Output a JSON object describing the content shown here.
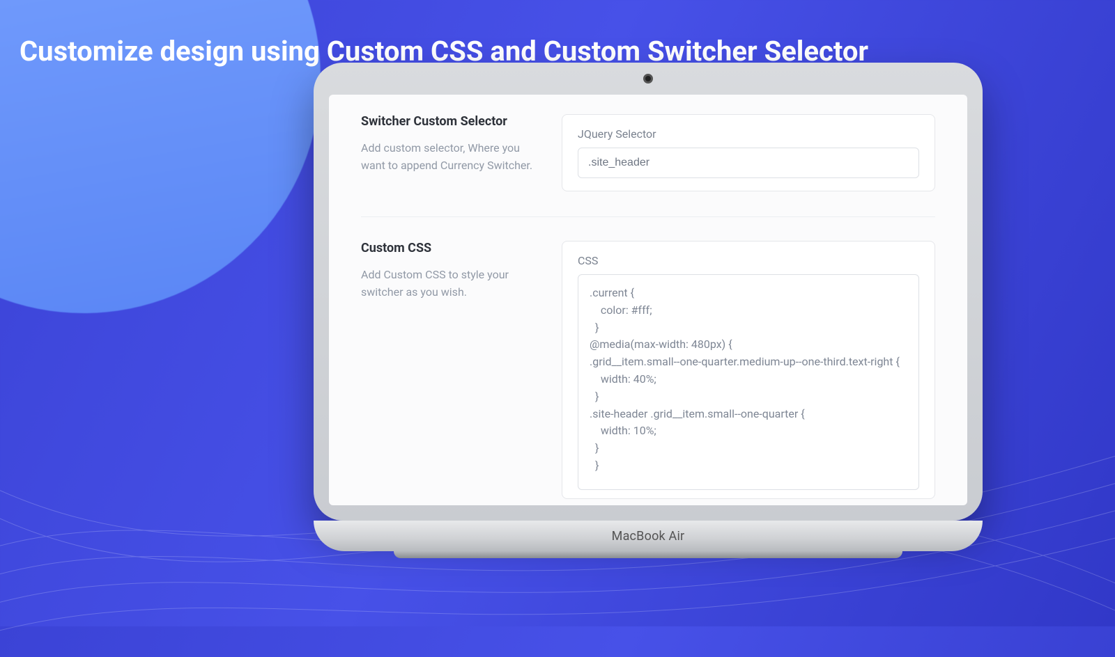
{
  "marketing": {
    "headline": "Customize design using Custom CSS and Custom Switcher Selector"
  },
  "device": {
    "brand": "MacBook Air"
  },
  "sections": {
    "selector": {
      "title": "Switcher Custom Selector",
      "description": "Add custom selector, Where you want to append Currency Switcher.",
      "field_label": "JQuery Selector",
      "value": ".site_header"
    },
    "css": {
      "title": "Custom CSS",
      "description": "Add Custom CSS to style your switcher as you wish.",
      "field_label": "CSS",
      "value": ".current {\n    color: #fff;\n  }\n@media(max-width: 480px) {\n.grid__item.small--one-quarter.medium-up--one-third.text-right {\n    width: 40%;\n  }\n.site-header .grid__item.small--one-quarter {\n    width: 10%;\n  }\n  }"
    }
  }
}
